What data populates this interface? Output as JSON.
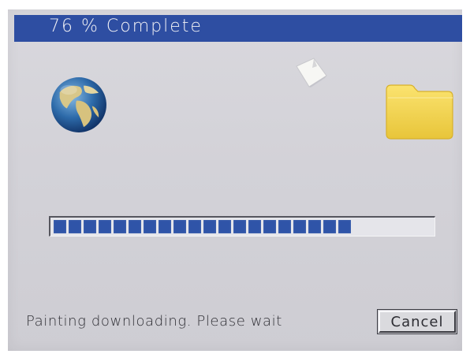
{
  "dialog": {
    "title": "76 % Complete",
    "progress_percent": 76,
    "progress_blocks_filled": 20,
    "status_text": "Painting downloading. Please wait",
    "cancel_label": "Cancel"
  },
  "icons": {
    "source": "globe-icon",
    "transfer": "paper-sheet-icon",
    "destination": "folder-icon"
  },
  "colors": {
    "titlebar": "#2e4ea2",
    "progress_block": "#2f54a8",
    "background": "#d5d4da",
    "folder": "#f0d24a"
  }
}
